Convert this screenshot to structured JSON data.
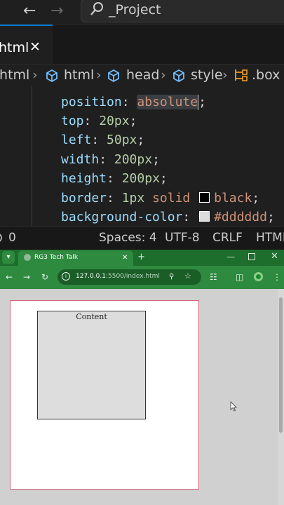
{
  "vscode": {
    "command_center": "_Project",
    "tab": {
      "label": "html"
    },
    "breadcrumb": {
      "file": ".html",
      "items": [
        "html",
        "head",
        "style",
        ".box"
      ]
    },
    "code": [
      {
        "prop": "position",
        "value": "absolute",
        "selected": true
      },
      {
        "prop": "top",
        "value": "20px"
      },
      {
        "prop": "left",
        "value": "50px"
      },
      {
        "prop": "width",
        "value": "200px"
      },
      {
        "prop": "height",
        "value": "200px"
      },
      {
        "prop": "border",
        "value1": "1px",
        "value2": "solid",
        "value3": "black",
        "swatch": "#000000"
      },
      {
        "prop": "background-color",
        "value": "#dddddd",
        "swatch": "#dddddd"
      }
    ],
    "status": {
      "problems": "0",
      "spaces": "Spaces: 4",
      "encoding": "UTF-8",
      "eol": "CRLF",
      "language": "HTML"
    }
  },
  "browser": {
    "tab_title": "RG3 Tech Talk",
    "url_host": "127.0.0.1",
    "url_rest": ":5500/index.html",
    "accent": "#2e8a3f",
    "page": {
      "inner_text": "Content"
    }
  },
  "icons": [
    "back-icon",
    "forward-icon",
    "search-icon",
    "close-icon",
    "cube-icon",
    "braces-icon",
    "reload-icon",
    "info-icon",
    "zoom-icon",
    "star-icon",
    "extensions-icon",
    "sidepanel-icon",
    "profile-icon",
    "menu-icon",
    "mouse-cursor-icon"
  ]
}
